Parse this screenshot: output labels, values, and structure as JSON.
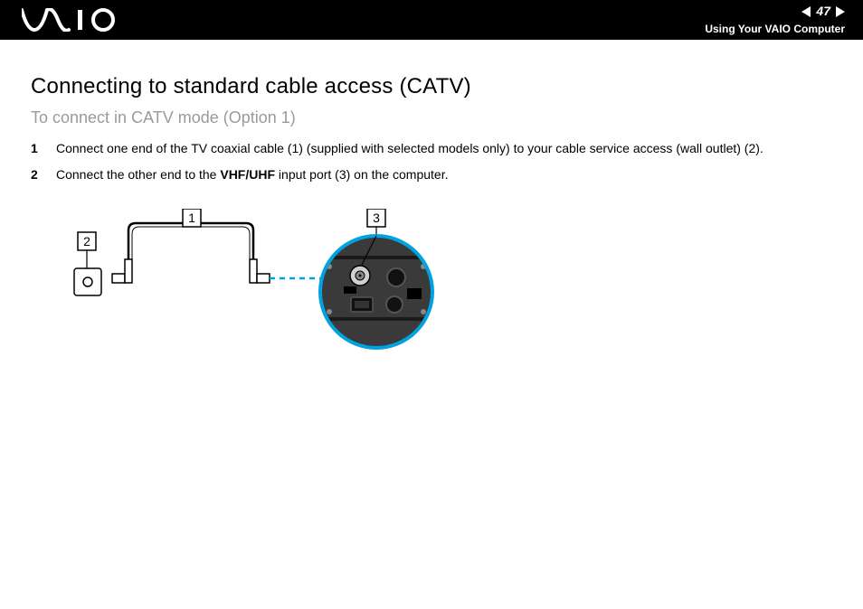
{
  "header": {
    "page_number": "47",
    "section_title": "Using Your VAIO Computer"
  },
  "body": {
    "title": "Connecting to standard cable access (CATV)",
    "subtitle": "To connect in CATV mode (Option 1)",
    "steps": [
      {
        "num": "1",
        "text_before": "Connect one end of the TV coaxial cable (1) (supplied with selected models only) to your cable service access (wall outlet) (2).",
        "bold": "",
        "text_after": ""
      },
      {
        "num": "2",
        "text_before": "Connect the other end to the ",
        "bold": "VHF/UHF",
        "text_after": " input port (3) on the computer."
      }
    ],
    "callouts": {
      "c1": "1",
      "c2": "2",
      "c3": "3"
    }
  }
}
